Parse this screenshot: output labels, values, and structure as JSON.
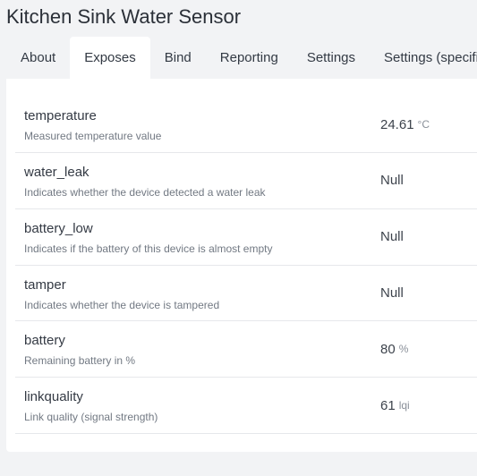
{
  "device": {
    "title": "Kitchen Sink Water Sensor"
  },
  "tabs": [
    {
      "label": "About"
    },
    {
      "label": "Exposes"
    },
    {
      "label": "Bind"
    },
    {
      "label": "Reporting"
    },
    {
      "label": "Settings"
    },
    {
      "label": "Settings (specific)"
    }
  ],
  "active_tab": "Exposes",
  "exposes": [
    {
      "name": "temperature",
      "description": "Measured temperature value",
      "value": "24.61",
      "unit": "°C"
    },
    {
      "name": "water_leak",
      "description": "Indicates whether the device detected a water leak",
      "value": "Null",
      "unit": ""
    },
    {
      "name": "battery_low",
      "description": "Indicates if the battery of this device is almost empty",
      "value": "Null",
      "unit": ""
    },
    {
      "name": "tamper",
      "description": "Indicates whether the device is tampered",
      "value": "Null",
      "unit": ""
    },
    {
      "name": "battery",
      "description": "Remaining battery in %",
      "value": "80",
      "unit": "%"
    },
    {
      "name": "linkquality",
      "description": "Link quality (signal strength)",
      "value": "61",
      "unit": "lqi"
    }
  ]
}
